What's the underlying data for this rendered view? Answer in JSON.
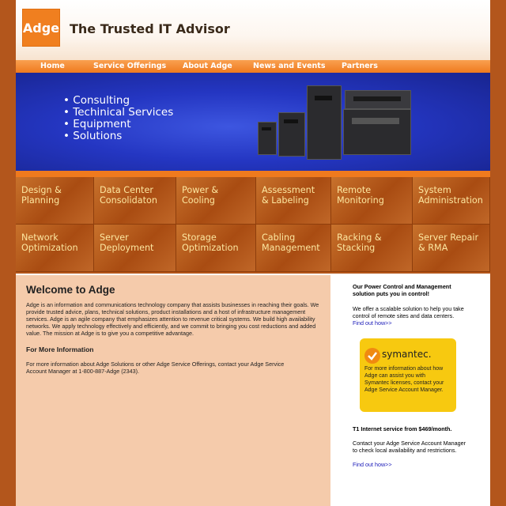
{
  "header": {
    "logo_text": "Adge",
    "tagline": "The Trusted IT Advisor"
  },
  "nav": {
    "items": [
      "Home",
      "Service Offerings",
      "About Adge",
      "News and Events",
      "Partners"
    ]
  },
  "banner": {
    "bullets": [
      "Consulting",
      "Techinical Services",
      "Equipment",
      "Solutions"
    ]
  },
  "services": [
    "Design &\nPlanning",
    "Data Center\nConsolidaton",
    "Power &\nCooling",
    "Assessment\n& Labeling",
    "Remote\nMonitoring",
    "System\nAdministration",
    "Network\nOptimization",
    "Server\nDeployment",
    "Storage\nOptimization",
    "Cabling\nManagement",
    "Racking &\nStacking",
    "Server Repair\n& RMA"
  ],
  "welcome": {
    "title": "Welcome to Adge",
    "body": "Adge is an information and communications technology company that assists businesses in reaching their goals. We provide trusted advice, plans, technical solutions, product installations and a host of infrastructure management services. Adge is an agile company that emphasizes attention to revenue critical systems. We build high availability networks. We apply technology effectively and efficiently, and we commit to bringing you cost reductions and added value. The mission at Adge is to give you a competitive advantage.",
    "more_heading": "For More Information",
    "more_body": "For more information about Adge Solutions or other Adge Service Offerings, contact your Adge Service Account Manager at 1-800-887-Adge (2343)."
  },
  "sidebar": {
    "power_heading": "Our Power Control and Management solution puts you in control!",
    "power_body": "We offer a scalable solution to help you take control of remote sites and data centers.",
    "find_out": "Find out how>>",
    "symantec_logo": "symantec.",
    "symantec_text": "For more information about how Adge can assist you with Symantec licenses, contact your Adge Service Account Manager.",
    "t1_heading": "T1 Internet service from $469/month.",
    "t1_body": "Contact your Adge Service Account Manager to check local availability and restrictions.",
    "find_out_2": "Find out how>>"
  },
  "colors": {
    "brand_orange": "#f07f1f",
    "outer_background": "#b3561c",
    "banner_blue": "#2436c2",
    "tile_text": "#fde7a0",
    "link": "#1a1ab8"
  }
}
